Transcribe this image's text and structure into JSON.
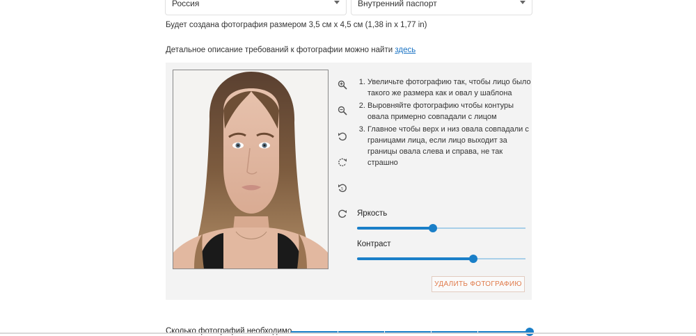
{
  "selects": {
    "country": "Россия",
    "document": "Внутренний паспорт"
  },
  "size_text": "Будет создана фотография размером 3,5 см х 4,5 см (1,38 in x 1,77 in)",
  "description": {
    "text": "Детальное описание требований к фотографии можно найти",
    "link": "здесь"
  },
  "tools": [
    "zoom-in-icon",
    "zoom-out-icon",
    "rotate-left-icon",
    "rotate-right-icon",
    "rotate-left-step-icon",
    "rotate-right-step-icon"
  ],
  "instructions": [
    "Увеличьте фотографию так, чтобы лицо было такого же размера как и овал у шаблона",
    "Выровняйте фотографию чтобы контуры овала примерно совпадали с лицом",
    "Главное чтобы верх и низ овала совпадали с границами лица, если лицо выходит за границы овала слева и справа, не так страшно"
  ],
  "sliders": {
    "brightness": {
      "label": "Яркость",
      "value": 0.45
    },
    "contrast": {
      "label": "Контраст",
      "value": 0.69
    }
  },
  "delete_button": "УДАЛИТЬ ФОТОГРАФИЮ",
  "copies": {
    "label": "Сколько фотографий необходимо",
    "value": 1.0,
    "steps": 5
  },
  "colors": {
    "accent": "#1a7fc8",
    "delete": "#e07a4a",
    "link": "#1a73c4"
  }
}
